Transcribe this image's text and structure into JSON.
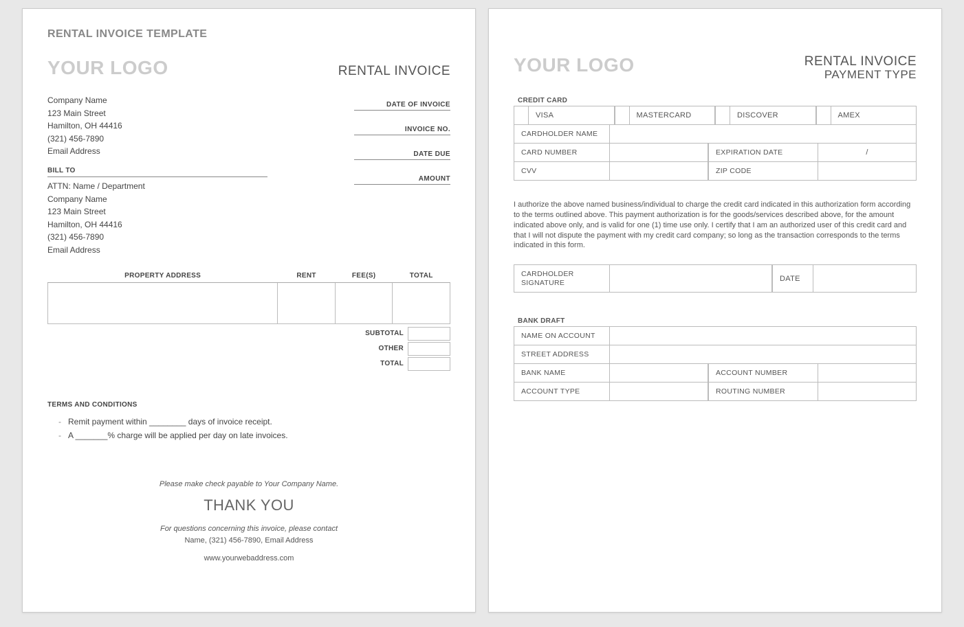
{
  "page1": {
    "template_title": "RENTAL INVOICE TEMPLATE",
    "logo": "YOUR LOGO",
    "header_right": "RENTAL INVOICE",
    "company": {
      "name": "Company Name",
      "street": "123 Main Street",
      "city": "Hamilton, OH  44416",
      "phone": "(321) 456-7890",
      "email": "Email Address"
    },
    "meta": {
      "date_of_invoice": "DATE OF INVOICE",
      "invoice_no": "INVOICE NO.",
      "date_due": "DATE DUE",
      "amount": "AMOUNT"
    },
    "bill_to_label": "BILL TO",
    "bill_to": {
      "attn": "ATTN: Name / Department",
      "name": "Company Name",
      "street": "123 Main Street",
      "city": "Hamilton, OH  44416",
      "phone": "(321) 456-7890",
      "email": "Email Address"
    },
    "table": {
      "headers": {
        "property": "PROPERTY ADDRESS",
        "rent": "RENT",
        "fees": "FEE(S)",
        "total": "TOTAL"
      }
    },
    "totals": {
      "subtotal": "SUBTOTAL",
      "other": "OTHER",
      "total": "TOTAL"
    },
    "terms_head": "TERMS AND CONDITIONS",
    "terms": [
      "Remit payment within ________ days of invoice receipt.",
      "A _______% charge will be applied per day on late invoices."
    ],
    "footer": {
      "payable": "Please make check payable to Your Company Name.",
      "thanks": "THANK YOU",
      "questions": "For questions concerning this invoice, please contact",
      "contact": "Name, (321) 456-7890, Email Address",
      "web": "www.yourwebaddress.com"
    }
  },
  "page2": {
    "logo": "YOUR LOGO",
    "header_right_1": "RENTAL INVOICE",
    "header_right_2": "PAYMENT TYPE",
    "cc_label": "CREDIT CARD",
    "cc_types": {
      "visa": "VISA",
      "mc": "MASTERCARD",
      "disc": "DISCOVER",
      "amex": "AMEX"
    },
    "cc_fields": {
      "name": "CARDHOLDER NAME",
      "number": "CARD NUMBER",
      "exp": "EXPIRATION DATE",
      "exp_val": "/",
      "cvv": "CVV",
      "zip": "ZIP CODE"
    },
    "auth": "I authorize the above named business/individual to charge the credit card indicated in this authorization form according to the terms outlined above. This payment authorization is for the goods/services described above, for the amount indicated above only, and is valid for one (1) time use only. I certify that I am an authorized user of this credit card and that I will not dispute the payment with my credit card company; so long as the transaction corresponds to the terms indicated in this form.",
    "sig": {
      "name": "CARDHOLDER SIGNATURE",
      "date": "DATE"
    },
    "bank_label": "BANK DRAFT",
    "bank": {
      "name": "NAME ON ACCOUNT",
      "street": "STREET ADDRESS",
      "bankname": "BANK NAME",
      "acctnum": "ACCOUNT NUMBER",
      "accttype": "ACCOUNT TYPE",
      "routing": "ROUTING NUMBER"
    }
  }
}
